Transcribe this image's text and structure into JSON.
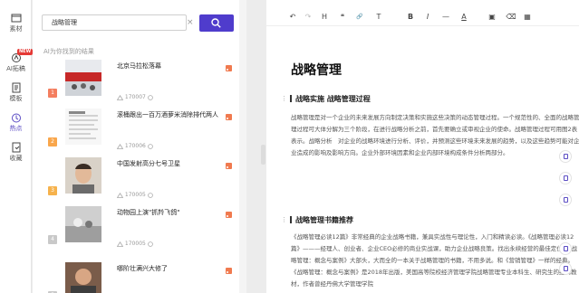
{
  "nav": [
    {
      "label": "素材",
      "icon": "material-icon"
    },
    {
      "label": "AI拓稿",
      "icon": "ai-icon",
      "badge": "NEW"
    },
    {
      "label": "模板",
      "icon": "template-icon"
    },
    {
      "label": "热点",
      "icon": "hot-icon",
      "active": true
    },
    {
      "label": "收藏",
      "icon": "favorite-icon"
    }
  ],
  "search": {
    "value": "战略管理",
    "clear": "×"
  },
  "results_hint": "AI为你找到的结果",
  "articles": [
    {
      "rank": "1",
      "title": "北京马拉松落幕",
      "views": "170007"
    },
    {
      "rank": "2",
      "title": "滚桶跟出一百万酒萝米消除排代两人",
      "views": "170006"
    },
    {
      "rank": "3",
      "title": "中国发射高分七号卫星",
      "views": "170005"
    },
    {
      "rank": "4",
      "title": "动物园上演\"抓羚飞鸽\"",
      "views": "170005"
    },
    {
      "rank": "5",
      "title": "哪阶壮满兴大修了",
      "views": "170005"
    }
  ],
  "toolbar": {
    "undo": "↶",
    "redo": "↷",
    "format": "H",
    "quote": "❝",
    "link": "🔗",
    "text": "T",
    "bold": "B",
    "italic": "I",
    "hr": "—",
    "color": "A",
    "image": "▣",
    "clear": "⌫",
    "table": "▦"
  },
  "doc": {
    "title": "战略管理",
    "sections": [
      {
        "heading": "战略实施 战略管理过程",
        "body": "战略管理是对一个企业的未来发展方向制定决策和实施这些决策的动态管理过程。一个规范性的、全面的战略管理过程可大体分解为三个阶段，在进行战略分析之前，首先要确立或审视企业的使命。战略管理过程可用图2表表示。战略分析　对企业的战略环境进行分析、评价，并预测这些环境未来发展的趋势，以及这些趋势可能对企业造成的影响及影响方向。企业外部环境因素和企业内部环境构成条件分析两部分。"
      },
      {
        "heading": "战略管理书籍推荐",
        "body": "《战略管理必读12篇》非常经典的企业战略书籍，兼具实战性与理论性，入门和精读必读。《战略管理必读12篇》———经理人、创业者、企业CEO必修的商业实战课，助力企业战略良策。找出永续经营的最佳定位。《战略管理：概念与案例》大部头，大而全的一本关于战略管理的书籍，不用多说。和《营销管理》一样的经典。《战略管理：概念与案例》是2018年出版，美国高等院校经济管理学院战略管理专业本科生、研究生的经典教材，作者曾经丹佛大学管理学院"
      }
    ]
  }
}
